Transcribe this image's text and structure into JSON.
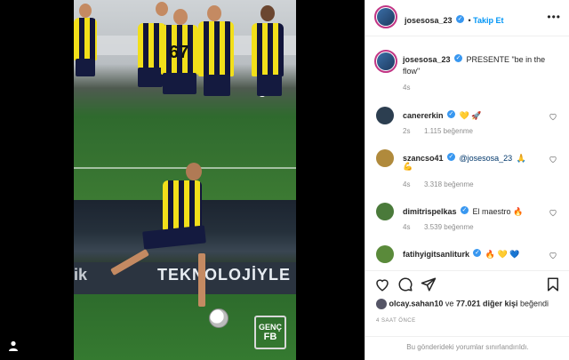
{
  "post": {
    "author": "josesosa_23",
    "follow_label": "Takip Et",
    "more_label": "•••"
  },
  "photo": {
    "board_text": "TEKNOLOJİYLE",
    "board_mark": "ik",
    "shirt_number": "67",
    "shirt_number_2": "3",
    "watermark_line1": "GENÇ",
    "watermark_line2": "FB"
  },
  "caption": {
    "username": "josesosa_23",
    "text": "PRESENTE \"be in the flow\"",
    "time": "4s"
  },
  "comments": [
    {
      "username": "canererkin",
      "text": "💛 🚀",
      "time": "2s",
      "likes": "1.115 beğenme"
    },
    {
      "username": "szancso41",
      "mention": "@josesosa_23",
      "text": "🙏",
      "extra": "💪",
      "time": "4s",
      "likes": "3.318 beğenme"
    },
    {
      "username": "dimitrispelkas",
      "text": "El maestro 🔥",
      "time": "4s",
      "likes": "3.539 beğenme"
    },
    {
      "username": "fatihyigitsanliturk",
      "text": "🔥 💛 💙"
    }
  ],
  "likes_row": {
    "first_liker": "olcay.sahan10",
    "joiner": "ve",
    "others": "77.021 diğer kişi",
    "suffix": "beğendi"
  },
  "time_ago": "4 SAAT ÖNCE",
  "restricted_text": "Bu gönderideki yorumlar sınırlandırıldı.",
  "colors": {
    "accent": "#0095f6",
    "verified": "#3897f0",
    "text": "#262626",
    "muted": "#8e8e8e"
  },
  "icons": [
    "heart-icon",
    "comment-icon",
    "share-icon",
    "bookmark-icon",
    "verified-icon",
    "user-icon"
  ]
}
